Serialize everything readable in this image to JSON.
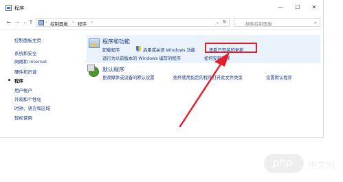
{
  "window": {
    "title": "程序",
    "icons": {
      "app": "control-panel-icon",
      "minimize": "minimize-icon",
      "maximize": "maximize-icon",
      "close": "close-icon"
    }
  },
  "address": {
    "breadcrumbs": [
      "控制面板",
      "程序"
    ],
    "separator": "›",
    "search_placeholder": "搜索控制面板"
  },
  "sidebar": {
    "items": [
      {
        "label": "控制面板主页",
        "active": false
      },
      {
        "label": "系统和安全",
        "active": false
      },
      {
        "label": "网络和 Internet",
        "active": false
      },
      {
        "label": "硬件和声音",
        "active": false
      },
      {
        "label": "程序",
        "active": true
      },
      {
        "label": "用户帐户",
        "active": false
      },
      {
        "label": "外观和个性化",
        "active": false
      },
      {
        "label": "时钟、语言和区域",
        "active": false
      },
      {
        "label": "轻松使用",
        "active": false
      }
    ]
  },
  "programs_and_features": {
    "title": "程序和功能",
    "links": {
      "uninstall": "卸载程序",
      "windows_features": "启用或关闭 Windows 功能",
      "view_updates": "查看已安装的更新",
      "run_older": "运行为以前版本的 Windows 编写的程序",
      "install": "如何安装程序"
    }
  },
  "default_programs": {
    "title": "默认程序",
    "links": {
      "change_media": "更改媒体或设备的默认设置",
      "file_type": "始终使用指定的程序打开此文件类型",
      "set_defaults": "设置默认程序"
    }
  },
  "annotation": {
    "color": "#e61e2a"
  },
  "watermark": {
    "latin": "php",
    "cn": "中文网"
  }
}
